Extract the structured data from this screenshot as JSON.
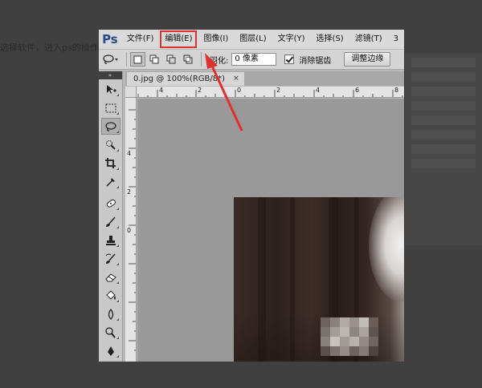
{
  "background": {
    "page_text": "选择软件，进入ps的操作"
  },
  "app": {
    "logo": "Ps",
    "menu": [
      {
        "label": "文件(F)"
      },
      {
        "label": "编辑(E)"
      },
      {
        "label": "图像(I)"
      },
      {
        "label": "图层(L)"
      },
      {
        "label": "文字(Y)"
      },
      {
        "label": "选择(S)"
      },
      {
        "label": "滤镜(T)"
      },
      {
        "label": "3"
      }
    ]
  },
  "options_bar": {
    "current_tool_icon": "lasso-icon",
    "selection_modes": [
      "new-selection-icon",
      "add-to-selection-icon",
      "subtract-from-selection-icon",
      "intersect-selection-icon"
    ],
    "feather_label": "羽化:",
    "feather_value": "0 像素",
    "anti_alias_label": "消除锯齿",
    "anti_alias_checked": true,
    "refine_edge_label": "调整边缘"
  },
  "toolbar": {
    "grip": "»",
    "tools": [
      {
        "icon": "move-icon",
        "active": false
      },
      {
        "icon": "marquee-icon",
        "active": false
      },
      {
        "icon": "lasso-icon",
        "active": true
      },
      {
        "icon": "quick-selection-icon",
        "active": false
      },
      {
        "icon": "crop-icon",
        "active": false
      },
      {
        "icon": "eyedropper-icon",
        "active": false
      },
      {
        "icon": "healing-brush-icon",
        "active": false
      },
      {
        "icon": "brush-icon",
        "active": false
      },
      {
        "icon": "clone-stamp-icon",
        "active": false
      },
      {
        "icon": "history-brush-icon",
        "active": false
      },
      {
        "icon": "eraser-icon",
        "active": false
      },
      {
        "icon": "paint-bucket-icon",
        "active": false
      },
      {
        "icon": "blur-icon",
        "active": false
      },
      {
        "icon": "dodge-icon",
        "active": false
      },
      {
        "icon": "pen-icon",
        "active": false
      }
    ]
  },
  "document": {
    "tab_title": "0.jpg @ 100%(RGB/8*)",
    "tab_close": "×",
    "ruler_top_labels": [
      "4",
      "2",
      "0",
      "2",
      "4",
      "6",
      "8"
    ],
    "ruler_left_labels": [
      "4",
      "2",
      "0"
    ]
  },
  "colors": {
    "annotation_red": "#e03030",
    "ps_logo_blue": "#2b4a8b"
  }
}
